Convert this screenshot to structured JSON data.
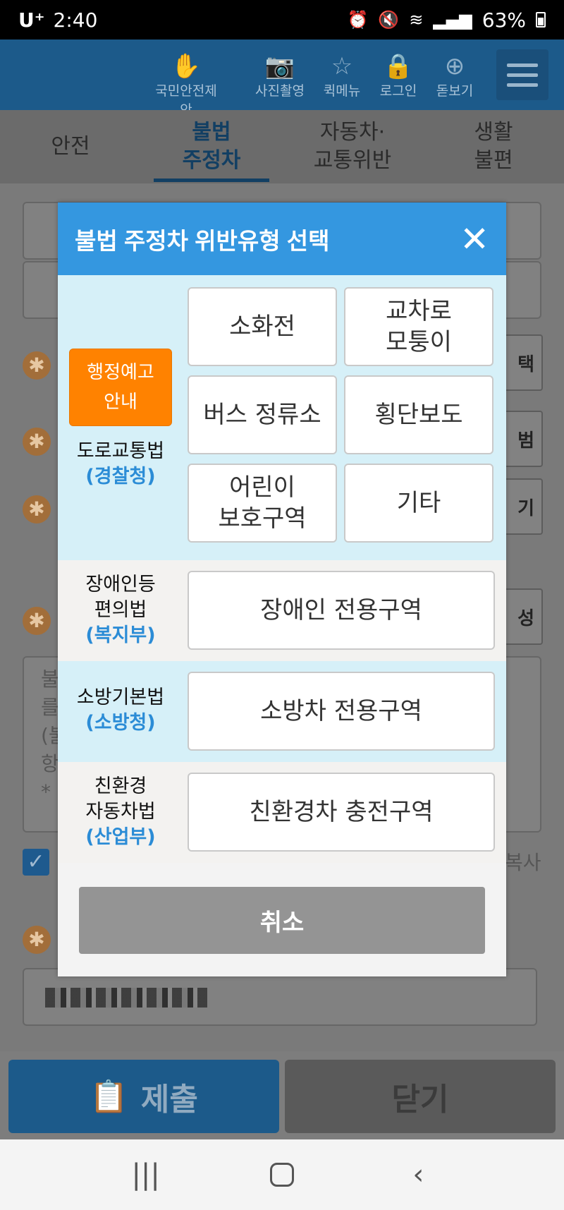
{
  "status_bar": {
    "carrier": "U⁺",
    "time": "2:40",
    "battery": "63%",
    "icons": [
      "alarm-icon",
      "mute-icon",
      "wifi-icon",
      "signal-icon",
      "battery-icon"
    ]
  },
  "header": {
    "quick_buttons": [
      {
        "label": "국민안전제안",
        "icon": "hand-person-icon"
      },
      {
        "label": "사진촬영",
        "icon": "camera-icon"
      },
      {
        "label": "퀵메뉴",
        "icon": "star-icon"
      },
      {
        "label": "로그인",
        "icon": "lock-icon"
      },
      {
        "label": "돋보기",
        "icon": "magnifier-icon"
      }
    ],
    "menu_icon": "hamburger-icon"
  },
  "tabs": [
    {
      "label": "안전",
      "active": false
    },
    {
      "label": "불법\n주정차",
      "active": true
    },
    {
      "label": "자동차·\n교통위반",
      "active": false
    },
    {
      "label": "생활\n불편",
      "active": false
    }
  ],
  "background_form": {
    "right_button_labels": [
      "택",
      "범",
      "기",
      "성"
    ],
    "copy_label": "복사",
    "text_lines": [
      "불",
      "를",
      "(불",
      "항",
      "*"
    ]
  },
  "modal": {
    "title": "불법 주정차 위반유형 선택",
    "sections": [
      {
        "law": "도로교통법",
        "agency": "(경찰청)",
        "notice_button": "행정예고\n안내",
        "options": [
          "소화전",
          "교차로\n모퉁이",
          "버스 정류소",
          "횡단보도",
          "어린이\n보호구역",
          "기타"
        ]
      },
      {
        "law": "장애인등\n편의법",
        "agency": "(복지부)",
        "options": [
          "장애인 전용구역"
        ]
      },
      {
        "law": "소방기본법",
        "agency": "(소방청)",
        "options": [
          "소방차 전용구역"
        ]
      },
      {
        "law": "친환경\n자동차법",
        "agency": "(산업부)",
        "options": [
          "친환경차 충전구역"
        ]
      }
    ],
    "cancel_label": "취소"
  },
  "bottom": {
    "submit_label": "제출",
    "close_label": "닫기"
  },
  "colors": {
    "modal_header": "#3497e0",
    "notice_orange": "#ff8200",
    "agency_blue": "#2b8cd6",
    "section_cyan": "#d6f0f8"
  }
}
